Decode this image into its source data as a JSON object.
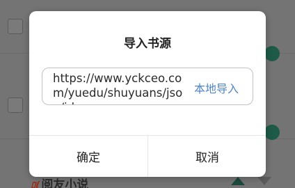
{
  "dialog": {
    "title": "导入书源",
    "url_value": "https://www.yckceo.com/yuedu/shuyuans/json/id",
    "local_import_label": "本地导入",
    "confirm_label": "确定",
    "cancel_label": "取消"
  },
  "background": {
    "source_tag": "ﾛ(",
    "source_name": "阅友小说",
    "toggle_color": "#1e5a48"
  }
}
